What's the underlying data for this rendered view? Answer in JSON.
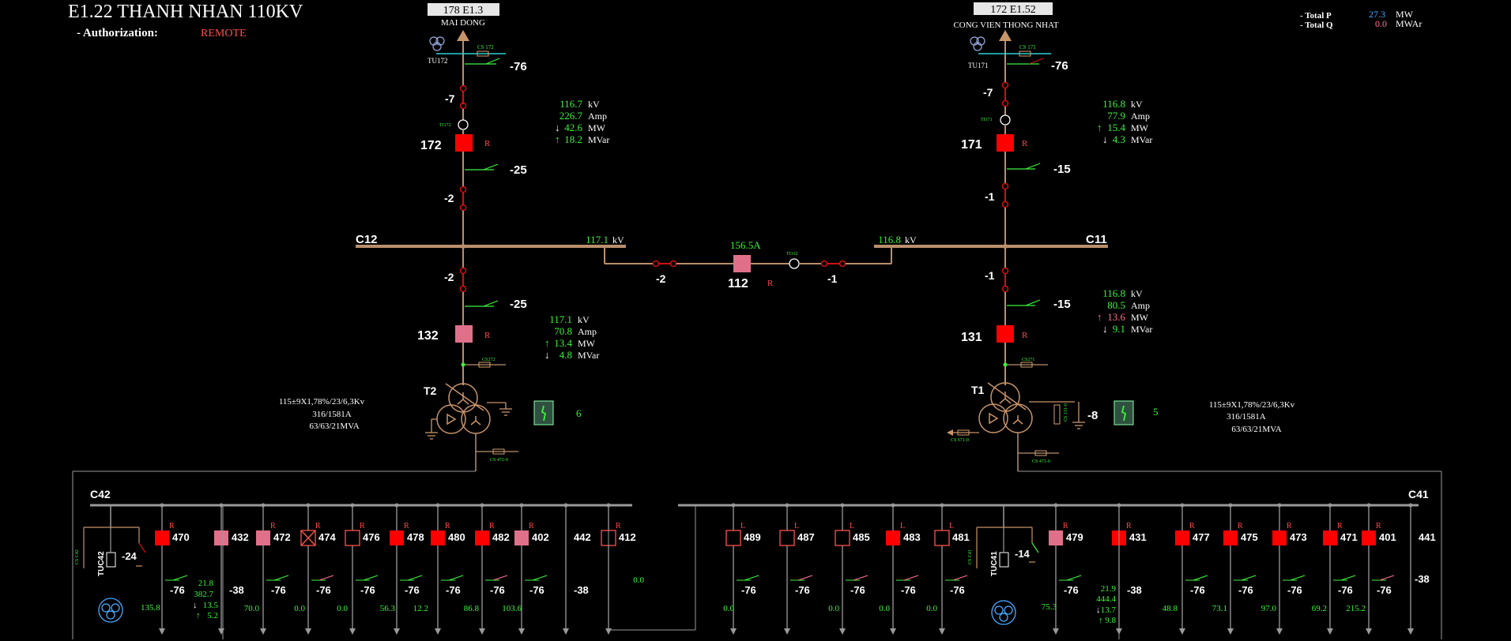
{
  "header": {
    "title": "E1.22 THANH NHAN 110KV",
    "auth_label": "- Authorization:",
    "auth_value": "REMOTE",
    "total_p_label": "- Total P",
    "total_p_value": "27.3",
    "total_p_unit": "MW",
    "total_q_label": "- Total Q",
    "total_q_value": "0.0",
    "total_q_unit": "MWAr"
  },
  "colors": {
    "busbar": "#b98f6c",
    "breaker_closed": "#ff0000",
    "breaker_pink": "#e0708a",
    "measure_green": "#3cf33c",
    "line_red": "#d01010",
    "gray": "#9a9a9a",
    "blue": "#4aa8ff",
    "pink_text": "#ff6f8f"
  },
  "left": {
    "line_name": "178 E1.3",
    "line_dest": "MAI DONG",
    "tu": "TU172",
    "cs": "CS 172",
    "ds76": "-76",
    "ds7": "-7",
    "ti": "TI172",
    "breaker": "172",
    "breaker_mode": "R",
    "ds25": "-25",
    "ds2": "-2",
    "kv": "116.7",
    "amp": "226.7",
    "mw": "42.6",
    "mvar": "18.2",
    "bus": "C12",
    "bus_kv": "117.1",
    "ds2b": "-2",
    "ds25b": "-25",
    "breaker2": "132",
    "breaker2_mode": "R",
    "kv2": "117.1",
    "amp2": "70.8",
    "mw2": "13.4",
    "mvar2": "4.8",
    "cs2": "CS272",
    "transformer": "T2",
    "tr_spec1": "115±9X1,78%/23/6,3Kv",
    "tr_spec2": "316/1581A",
    "tr_spec3": "63/63/21MVA",
    "tap": "6",
    "cs3": "CS 472-0"
  },
  "right": {
    "line_name": "172 E1.52",
    "line_dest": "CONG VIEN THONG NHAT",
    "tu": "TU171",
    "cs": "CS 171",
    "ds76": "-76",
    "ds7": "-7",
    "ti": "TI171",
    "breaker": "171",
    "breaker_mode": "R",
    "ds15": "-15",
    "ds1": "-1",
    "kv": "116.8",
    "amp": "77.9",
    "mw": "15.4",
    "mvar": "4.3",
    "bus": "C11",
    "bus_kv": "116.8",
    "ds1b": "-1",
    "ds15b": "-15",
    "breaker2": "131",
    "breaker2_mode": "R",
    "kv2": "116.8",
    "amp2": "80.5",
    "mw2": "13.6",
    "mvar2": "9.1",
    "cs2": "CS271",
    "transformer": "T1",
    "tr_spec1": "115±9X1,78%/23/6,3Kv",
    "tr_spec2": "316/1581A",
    "tr_spec3": "63/63/21MVA",
    "tap": "5",
    "ds8": "-8",
    "cs3": "CS 471-0",
    "cs4": "CS 671-0",
    "cs5": "CS 131-0"
  },
  "coupler": {
    "breaker": "112",
    "mode": "R",
    "amp": "156.5A",
    "ds_left": "-2",
    "ds_right": "-1",
    "ti": "TI112"
  },
  "units": {
    "kv": "kV",
    "amp": "Amp",
    "mw": "MW",
    "mvar": "MVar"
  },
  "c42": {
    "bus": "C42",
    "tuc": "TUC42",
    "tuc_ds": "-24",
    "tuc_cs": "CS C42",
    "tuc_mw": "135.8",
    "feeders": [
      {
        "name": "470",
        "mode": "R",
        "ds": "-76",
        "val": "21.8"
      },
      {
        "name": "432",
        "mode": "",
        "ds": "-38",
        "val": "70.0"
      },
      {
        "name": "472",
        "mode": "R",
        "ds": "-76",
        "val": "0.0"
      },
      {
        "name": "474",
        "mode": "R",
        "ds": "-76",
        "val": "0.0"
      },
      {
        "name": "476",
        "mode": "R",
        "ds": "-76",
        "val": "56.3"
      },
      {
        "name": "478",
        "mode": "R",
        "ds": "-76",
        "val": "12.2"
      },
      {
        "name": "480",
        "mode": "R",
        "ds": "-76",
        "val": "86.8"
      },
      {
        "name": "482",
        "mode": "R",
        "ds": "-76",
        "val": "103.6"
      },
      {
        "name": "402",
        "mode": "R",
        "ds": "-76",
        "val": ""
      },
      {
        "name": "442",
        "mode": "",
        "ds": "-38",
        "val": ""
      },
      {
        "name": "412",
        "mode": "R",
        "ds": "",
        "val": "0.0"
      }
    ],
    "f470_extra": [
      "382.7",
      "13.5",
      "5.2"
    ]
  },
  "c41": {
    "bus": "C41",
    "tuc": "TUC41",
    "tuc_ds": "-14",
    "tuc_cs": "CS C41",
    "feeders": [
      {
        "name": "489",
        "mode": "L",
        "ds": "-76",
        "val": "0.0"
      },
      {
        "name": "487",
        "mode": "L",
        "ds": "-76",
        "val": ""
      },
      {
        "name": "485",
        "mode": "L",
        "ds": "-76",
        "val": "0.0"
      },
      {
        "name": "483",
        "mode": "L",
        "ds": "-76",
        "val": "0.0"
      },
      {
        "name": "481",
        "mode": "L",
        "ds": "-76",
        "val": "0.0"
      },
      {
        "name": "479",
        "mode": "R",
        "ds": "-76",
        "val": "75.3"
      },
      {
        "name": "431",
        "mode": "R",
        "ds": "-38",
        "val": "21.9"
      },
      {
        "name": "477",
        "mode": "R",
        "ds": "-76",
        "val": "48.8"
      },
      {
        "name": "475",
        "mode": "R",
        "ds": "-76",
        "val": "73.1"
      },
      {
        "name": "473",
        "mode": "R",
        "ds": "-76",
        "val": "97.0"
      },
      {
        "name": "471",
        "mode": "R",
        "ds": "-76",
        "val": "69.2"
      },
      {
        "name": "401",
        "mode": "R",
        "ds": "-76",
        "val": "215.2"
      },
      {
        "name": "441",
        "mode": "",
        "ds": "-38",
        "val": ""
      }
    ],
    "f431_extra": [
      "444.4",
      "13.7",
      "9.8"
    ]
  }
}
